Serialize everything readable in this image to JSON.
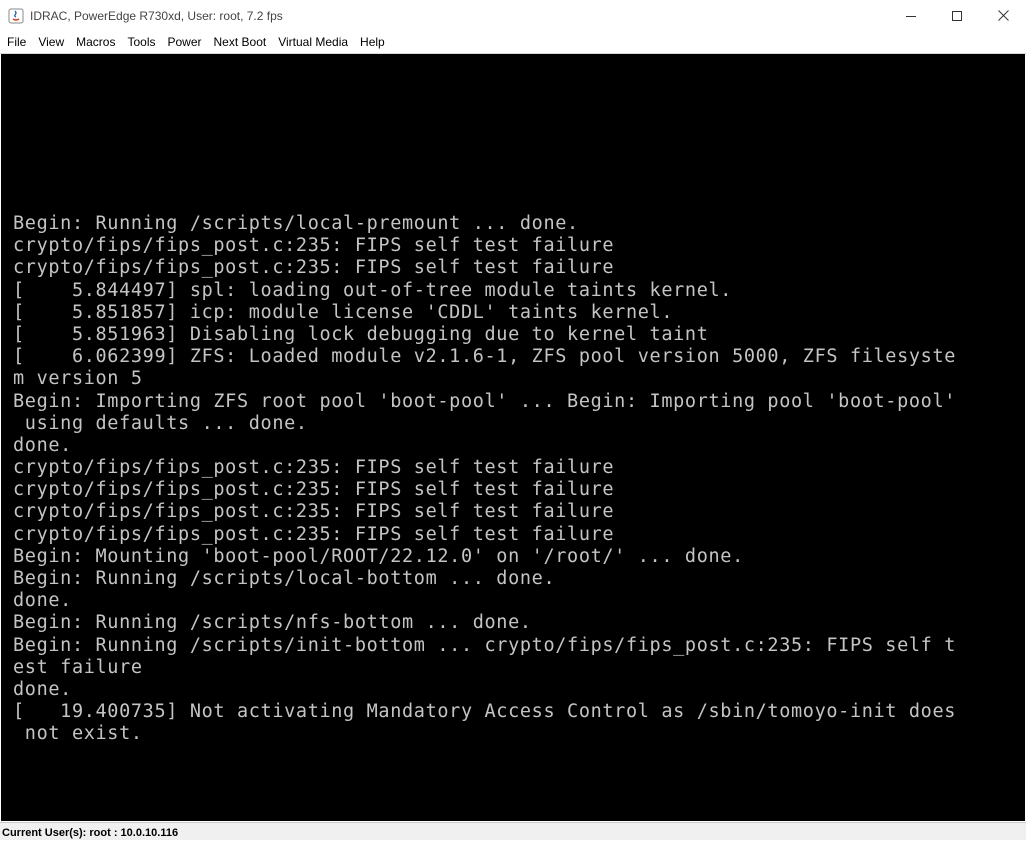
{
  "window": {
    "title": "IDRAC, PowerEdge R730xd, User: root, 7.2 fps",
    "icon": "java-icon",
    "controls": {
      "minimize": "—",
      "maximize": "☐",
      "close": "✕"
    }
  },
  "menubar": {
    "items": [
      "File",
      "View",
      "Macros",
      "Tools",
      "Power",
      "Next Boot",
      "Virtual Media",
      "Help"
    ]
  },
  "console": {
    "lines": [
      "Begin: Running /scripts/local-premount ... done.",
      "crypto/fips/fips_post.c:235: FIPS self test failure",
      "crypto/fips/fips_post.c:235: FIPS self test failure",
      "[    5.844497] spl: loading out-of-tree module taints kernel.",
      "[    5.851857] icp: module license 'CDDL' taints kernel.",
      "[    5.851963] Disabling lock debugging due to kernel taint",
      "[    6.062399] ZFS: Loaded module v2.1.6-1, ZFS pool version 5000, ZFS filesyste",
      "m version 5",
      "Begin: Importing ZFS root pool 'boot-pool' ... Begin: Importing pool 'boot-pool'",
      " using defaults ... done.",
      "done.",
      "crypto/fips/fips_post.c:235: FIPS self test failure",
      "crypto/fips/fips_post.c:235: FIPS self test failure",
      "crypto/fips/fips_post.c:235: FIPS self test failure",
      "crypto/fips/fips_post.c:235: FIPS self test failure",
      "Begin: Mounting 'boot-pool/ROOT/22.12.0' on '/root/' ... done.",
      "Begin: Running /scripts/local-bottom ... done.",
      "done.",
      "Begin: Running /scripts/nfs-bottom ... done.",
      "Begin: Running /scripts/init-bottom ... crypto/fips/fips_post.c:235: FIPS self t",
      "est failure",
      "done.",
      "[   19.400735] Not activating Mandatory Access Control as /sbin/tomoyo-init does",
      " not exist."
    ]
  },
  "statusbar": {
    "text": "Current User(s): root : 10.0.10.116"
  }
}
